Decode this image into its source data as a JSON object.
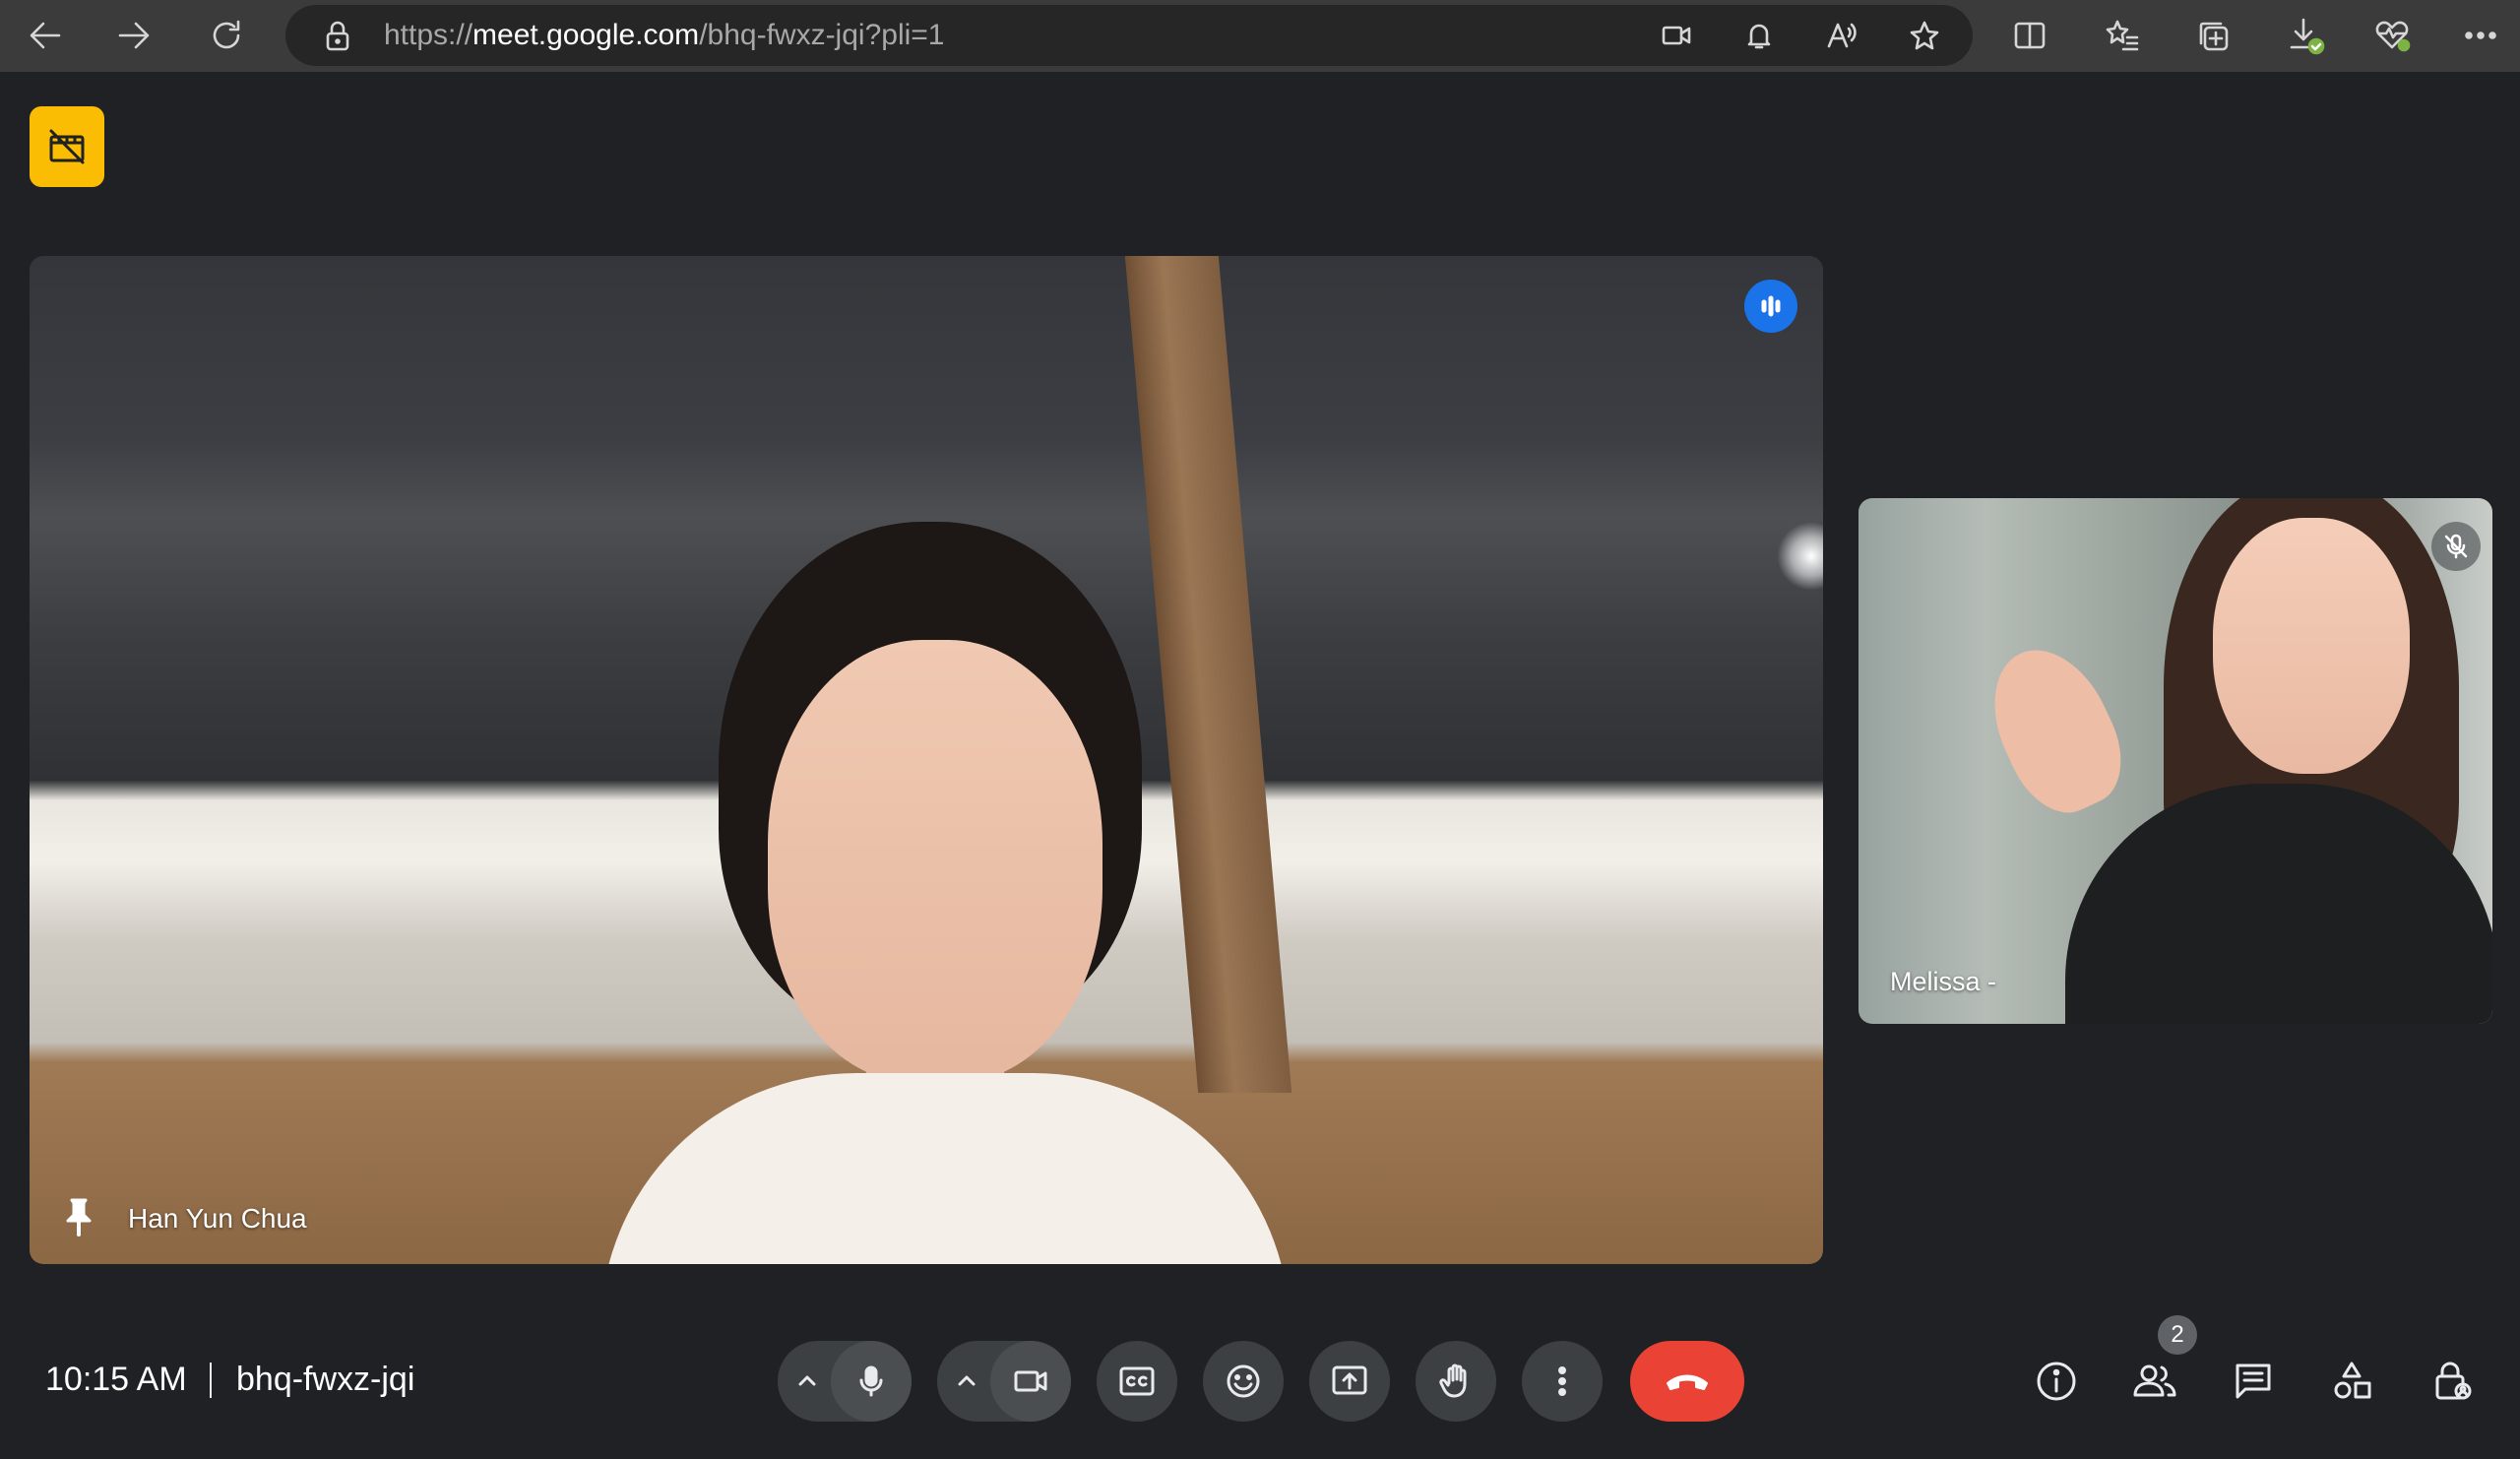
{
  "browser": {
    "url_prefix": "https://",
    "url_host": "meet.google.com",
    "url_path": "/bhq-fwxz-jqi?pli=1",
    "nav_icons": [
      "back-arrow-icon",
      "forward-arrow-icon",
      "refresh-icon"
    ],
    "address_icons": [
      "lock-icon",
      "camera-icon",
      "bell-icon",
      "read-aloud-icon",
      "favorite-star-icon"
    ],
    "toolbar_icons": [
      "split-screen-icon",
      "favorites-icon",
      "collections-icon",
      "downloads-icon",
      "browser-essentials-icon",
      "more-icon"
    ]
  },
  "meeting": {
    "recording_badge_icon": "recording-off-icon",
    "main_participant": {
      "name": "Han Yun Chua",
      "pinned": true,
      "speaking": true
    },
    "side_participant": {
      "name": "Melissa -",
      "muted": true
    },
    "time": "10:15 AM",
    "code": "bhq-fwxz-jqi",
    "participant_count": "2",
    "accent_colors": {
      "end_call": "#ea4335",
      "speaking": "#1a73e8",
      "recording": "#fbbc04"
    }
  }
}
